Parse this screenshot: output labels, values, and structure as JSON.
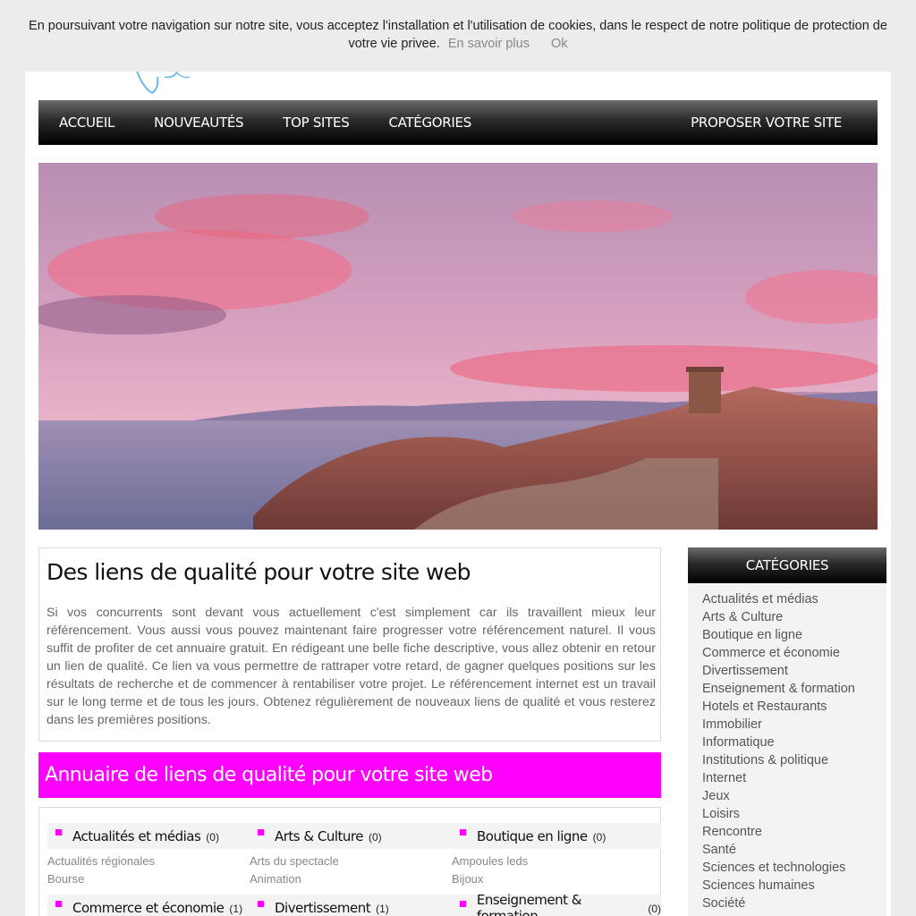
{
  "cookie": {
    "message": "En poursuivant votre navigation sur notre site, vous acceptez l'installation et l'utilisation de cookies, dans le respect de notre politique de protection de votre vie privee.",
    "more_link": "En savoir plus",
    "ok_button": "Ok"
  },
  "nav": {
    "accueil": "ACCUEIL",
    "nouveautes": "NOUVEAUTÉS",
    "top_sites": "TOP SITES",
    "categories": "CATÉGORIES",
    "proposer": "PROPOSER VOTRE SITE"
  },
  "intro": {
    "title": "Des liens de qualité pour votre site web",
    "text": "Si vos concurrents sont devant vous actuellement c'est simplement car ils travaillent mieux leur référencement. Vous aussi vous pouvez maintenant faire progresser votre référencement naturel. Il vous suffit de profiter de cet annuaire gratuit. En rédigeant une belle fiche descriptive, vous allez obtenir en retour un lien de qualité. Ce lien va vous permettre de rattraper votre retard, de gagner quelques positions sur les résultats de recherche et de commencer à rentabiliser votre projet. Le référencement internet est un travail sur le long terme et de tous les jours. Obtenez régulièrement de nouveaux liens de qualité et vous resterez dans les premières positions."
  },
  "directory": {
    "title": "Annuaire de liens de qualité pour votre site web",
    "row1": [
      {
        "name": "Actualités et médias",
        "count": "(0)",
        "subs": [
          "Actualités régionales",
          "Bourse"
        ]
      },
      {
        "name": "Arts & Culture",
        "count": "(0)",
        "subs": [
          "Arts du spectacle",
          "Animation"
        ]
      },
      {
        "name": "Boutique en ligne",
        "count": "(0)",
        "subs": [
          "Ampoules leds",
          "Bijoux"
        ]
      }
    ],
    "row2": [
      {
        "name": "Commerce et économie",
        "count": "(1)"
      },
      {
        "name": "Divertissement",
        "count": "(1)"
      },
      {
        "name": "Enseignement & formation",
        "count": "(0)"
      }
    ]
  },
  "sidebar": {
    "title": "CATÉGORIES",
    "items": [
      "Actualités et médias",
      "Arts & Culture",
      "Boutique en ligne",
      "Commerce et économie",
      "Divertissement",
      "Enseignement & formation",
      "Hotels et Restaurants",
      "Immobilier",
      "Informatique",
      "Institutions & politique",
      "Internet",
      "Jeux",
      "Loisirs",
      "Rencontre",
      "Santé",
      "Sciences et technologies",
      "Sciences humaines",
      "Société"
    ]
  },
  "colors": {
    "accent": "#ff00ff",
    "nav_bg": "#000000"
  }
}
